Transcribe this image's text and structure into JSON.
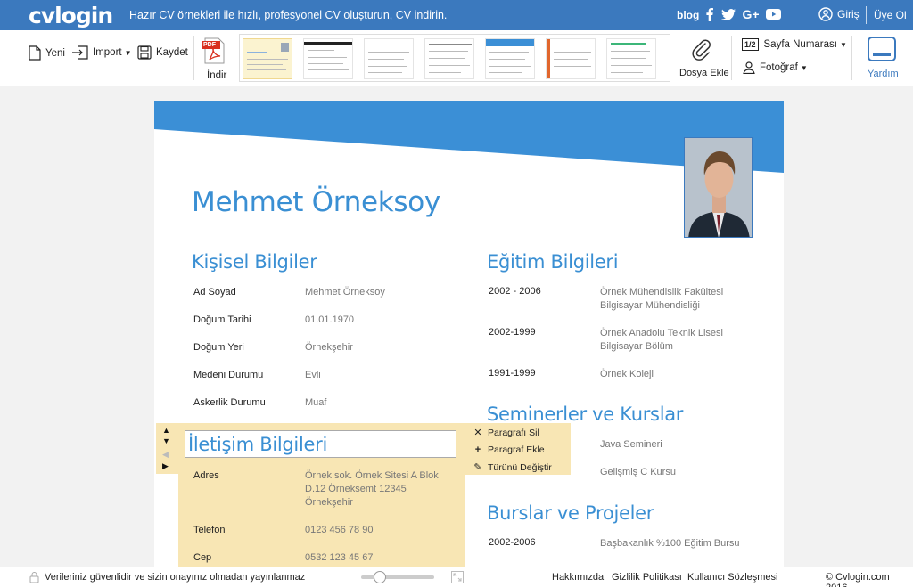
{
  "header": {
    "logo": "cvlogin",
    "tagline": "Hazır CV örnekleri ile hızlı, profesyonel CV oluşturun, CV indirin.",
    "blog": "blog",
    "social_icons": [
      "facebook-icon",
      "twitter-icon",
      "google-plus-icon",
      "youtube-icon"
    ],
    "login": "Giriş",
    "signup": "Üye Ol"
  },
  "toolbar": {
    "new_label": "Yeni",
    "import_label": "Import",
    "save_label": "Kaydet",
    "download_label": "İndir",
    "pdf_badge": "PDF",
    "attach_label": "Dosya Ekle",
    "page_number_badge": "1/2",
    "page_number_label": "Sayfa Numarası",
    "photo_label": "Fotoğraf",
    "help_label": "Yardım",
    "template_count": 7,
    "selected_template": 1
  },
  "cv": {
    "name": "Mehmet Örneksoy",
    "personal": {
      "title": "Kişisel Bilgiler",
      "rows": [
        {
          "label": "Ad Soyad",
          "value": "Mehmet Örneksoy"
        },
        {
          "label": "Doğum Tarihi",
          "value": "01.01.1970"
        },
        {
          "label": "Doğum Yeri",
          "value": "Örnekşehir"
        },
        {
          "label": "Medeni Durumu",
          "value": "Evli"
        },
        {
          "label": "Askerlik Durumu",
          "value": "Muaf"
        }
      ]
    },
    "contact": {
      "title": "İletişim Bilgileri",
      "rows": [
        {
          "label": "Adres",
          "value_lines": [
            "Örnek sok. Örnek Sitesi A Blok",
            "D.12 Örneksemt 12345",
            "Örnekşehir"
          ]
        },
        {
          "label": "Telefon",
          "value": "0123 456 78 90"
        },
        {
          "label": "Cep",
          "value": "0532 123 45 67"
        }
      ]
    },
    "education": {
      "title": "Eğitim Bilgileri",
      "rows": [
        {
          "year": "2002 - 2006",
          "lines": [
            "Örnek Mühendislik Fakültesi",
            "Bilgisayar Mühendisliği"
          ]
        },
        {
          "year": "2002-1999",
          "lines": [
            "Örnek Anadolu Teknik Lisesi",
            "Bilgisayar Bölüm"
          ]
        },
        {
          "year": "1991-1999",
          "lines": [
            "Örnek Koleji"
          ]
        }
      ]
    },
    "seminars": {
      "title": "Seminerler ve Kurslar",
      "rows": [
        {
          "value": "Java Semineri"
        },
        {
          "value": "Gelişmiş C Kursu"
        }
      ]
    },
    "scholarships": {
      "title": "Burslar ve Projeler",
      "rows": [
        {
          "year": "2002-2006",
          "value": "Başbakanlık %100 Eğitim Bursu"
        }
      ]
    }
  },
  "context_menu": {
    "delete": "Paragrafı Sil",
    "add": "Paragraf Ekle",
    "change_type": "Türünü Değiştir"
  },
  "footer": {
    "security_note": "Verileriniz güvenlidir ve sizin onayınız olmadan yayınlanmaz",
    "zoom_level": 0.2,
    "about": "Hakkımızda",
    "privacy": "Gizlilik Politikası",
    "terms": "Kullanıcı Sözleşmesi",
    "copyright": "© Cvlogin.com 2016"
  },
  "colors": {
    "brand_blue": "#3b79be",
    "heading_blue": "#3a8fd3",
    "selection": "#f8e6b4"
  }
}
